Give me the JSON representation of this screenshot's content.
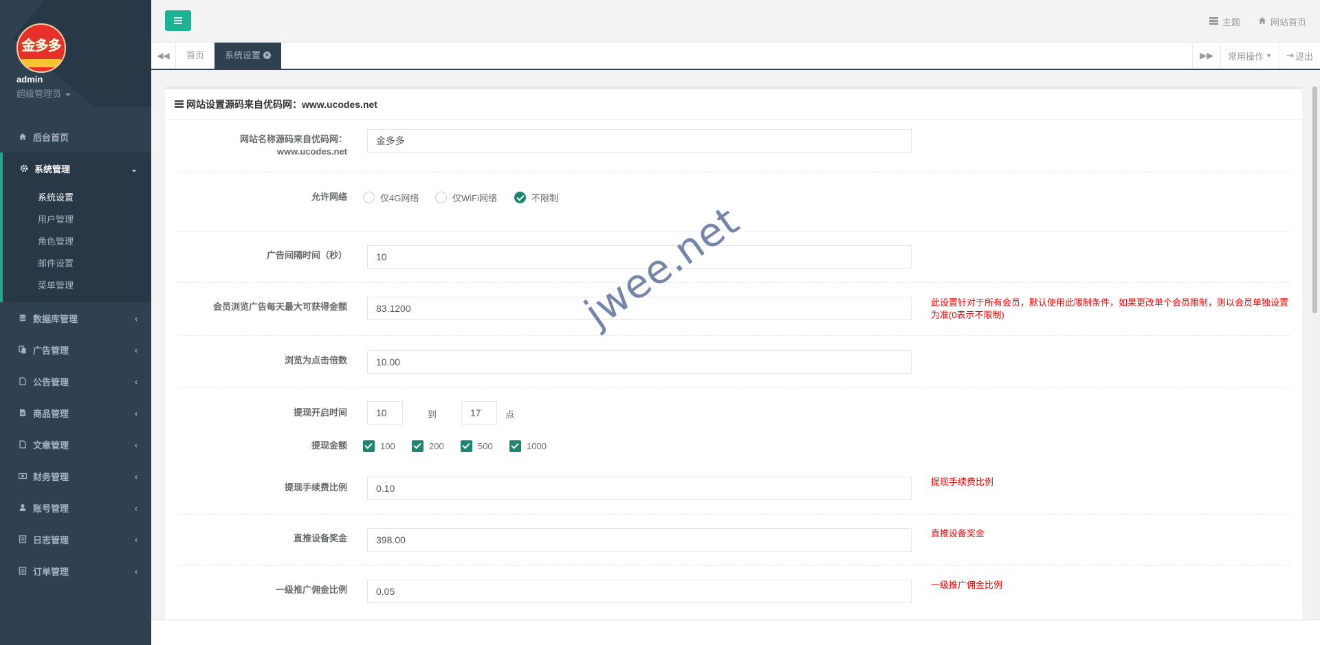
{
  "profile": {
    "name": "admin",
    "role": "超级管理员",
    "logo_text": "金多多"
  },
  "sidebar": {
    "home": "后台首页",
    "system": "系统管理",
    "system_sub": [
      "系统设置",
      "用户管理",
      "角色管理",
      "邮件设置",
      "菜单管理"
    ],
    "items": [
      "数据库管理",
      "广告管理",
      "公告管理",
      "商品管理",
      "文章管理",
      "财务管理",
      "账号管理",
      "日志管理",
      "订单管理"
    ]
  },
  "topbar": {
    "theme": "主题",
    "site_home": "网站首页"
  },
  "tabs": {
    "items": [
      "首页",
      "系统设置"
    ],
    "common_ops": "常用操作",
    "logout": "退出"
  },
  "panel": {
    "title": "网站设置源码来自优码网：www.ucodes.net"
  },
  "form": {
    "site_name_label_1": "网站名称源码来自优码网：",
    "site_name_label_2": "www.ucodes.net",
    "site_name_value": "金多多",
    "network_label": "允许网络",
    "network_options": [
      "仅4G网络",
      "仅WiFi网络",
      "不限制"
    ],
    "network_selected": "不限制",
    "ad_interval_label": "广告间隔时间（秒）",
    "ad_interval_value": "10",
    "max_earn_label": "会员浏览广告每天最大可获得金额",
    "max_earn_value": "83.1200",
    "max_earn_help": "此设置针对于所有会员，默认使用此限制条件，如果更改单个会员限制，则以会员单独设置为准(0表示不限制)",
    "click_ratio_label": "浏览为点击倍数",
    "click_ratio_value": "10.00",
    "withdraw_time_label": "提现开启时间",
    "withdraw_from": "10",
    "to_text": "到",
    "withdraw_to": "17",
    "point_text": "点",
    "withdraw_amount_label": "提现金额",
    "withdraw_amounts": [
      "100",
      "200",
      "500",
      "1000"
    ],
    "fee_label": "提现手续费比例",
    "fee_value": "0.10",
    "fee_help": "提现手续费比例",
    "direct_bonus_label": "直推设备奖金",
    "direct_bonus_value": "398.00",
    "direct_bonus_help": "直推设备奖金",
    "level1_label": "一级推广佣金比例",
    "level1_value": "0.05",
    "level1_help": "一级推广佣金比例"
  },
  "watermark": "jwee.net",
  "colors": {
    "sidebar_bg": "#2f4050",
    "accent": "#1ab394",
    "check": "#1c8770",
    "help": "#ff0000"
  }
}
